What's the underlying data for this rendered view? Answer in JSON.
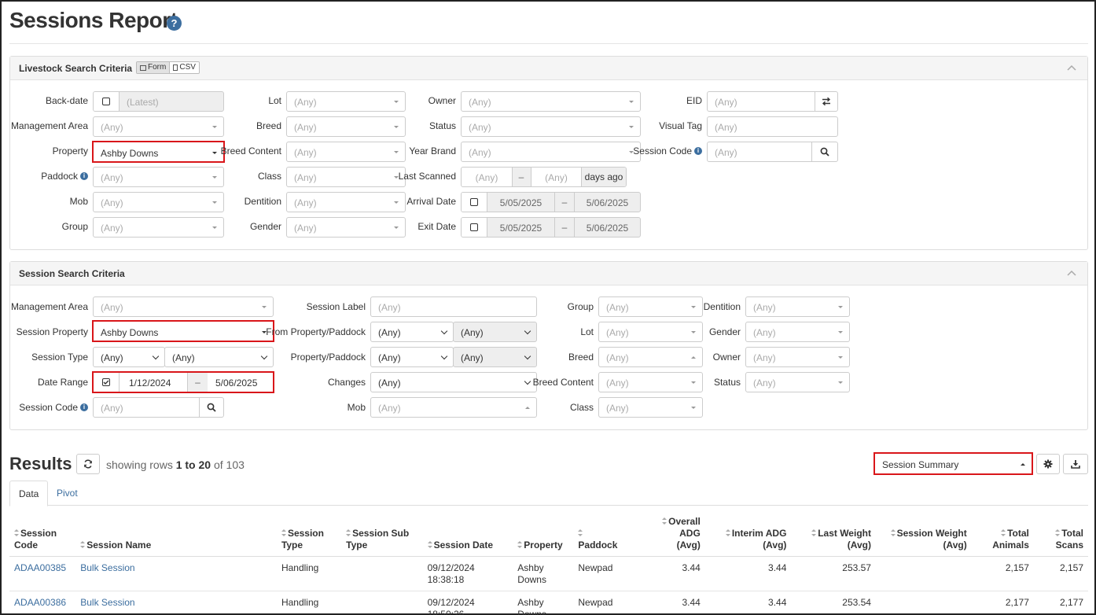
{
  "page": {
    "title": "Sessions Report",
    "help": "?"
  },
  "livestock": {
    "title": "Livestock Search Criteria",
    "form_label": "Form",
    "csv_label": "CSV",
    "backdate": {
      "label": "Back-date",
      "value": "(Latest)"
    },
    "mgmt_area": {
      "label": "Management Area",
      "value": "(Any)"
    },
    "property": {
      "label": "Property",
      "value": "Ashby Downs"
    },
    "paddock": {
      "label": "Paddock",
      "value": "(Any)"
    },
    "mob": {
      "label": "Mob",
      "value": "(Any)"
    },
    "group": {
      "label": "Group",
      "value": "(Any)"
    },
    "lot": {
      "label": "Lot",
      "value": "(Any)"
    },
    "breed": {
      "label": "Breed",
      "value": "(Any)"
    },
    "breed_content": {
      "label": "Breed Content",
      "value": "(Any)"
    },
    "class": {
      "label": "Class",
      "value": "(Any)"
    },
    "dentition": {
      "label": "Dentition",
      "value": "(Any)"
    },
    "gender": {
      "label": "Gender",
      "value": "(Any)"
    },
    "owner": {
      "label": "Owner",
      "value": "(Any)"
    },
    "status": {
      "label": "Status",
      "value": "(Any)"
    },
    "year_brand": {
      "label": "Year Brand",
      "value": "(Any)"
    },
    "last_scanned": {
      "label": "Last Scanned",
      "from": "(Any)",
      "sep": "–",
      "to": "(Any)",
      "suffix": "days ago"
    },
    "arrival_date": {
      "label": "Arrival Date",
      "from": "5/05/2025",
      "sep": "–",
      "to": "5/06/2025"
    },
    "exit_date": {
      "label": "Exit Date",
      "from": "5/05/2025",
      "sep": "–",
      "to": "5/06/2025"
    },
    "eid": {
      "label": "EID",
      "value": "(Any)"
    },
    "visual_tag": {
      "label": "Visual Tag",
      "value": "(Any)"
    },
    "session_code": {
      "label": "Session Code",
      "value": "(Any)"
    }
  },
  "session": {
    "title": "Session Search Criteria",
    "mgmt_area": {
      "label": "Management Area",
      "value": "(Any)"
    },
    "session_property": {
      "label": "Session Property",
      "value": "Ashby Downs"
    },
    "session_type": {
      "label": "Session Type",
      "value1": "(Any)",
      "value2": "(Any)"
    },
    "date_range": {
      "label": "Date Range",
      "from": "1/12/2024",
      "sep": "–",
      "to": "5/06/2025"
    },
    "session_code": {
      "label": "Session Code",
      "value": "(Any)"
    },
    "session_label": {
      "label": "Session Label",
      "value": "(Any)"
    },
    "from_prop": {
      "label": "From Property/Paddock",
      "value1": "(Any)",
      "value2": "(Any)"
    },
    "prop_paddock": {
      "label": "Property/Paddock",
      "value1": "(Any)",
      "value2": "(Any)"
    },
    "changes": {
      "label": "Changes",
      "value": "(Any)"
    },
    "mob": {
      "label": "Mob",
      "value": "(Any)"
    },
    "group": {
      "label": "Group",
      "value": "(Any)"
    },
    "lot": {
      "label": "Lot",
      "value": "(Any)"
    },
    "breed": {
      "label": "Breed",
      "value": "(Any)"
    },
    "breed_content": {
      "label": "Breed Content",
      "value": "(Any)"
    },
    "class": {
      "label": "Class",
      "value": "(Any)"
    },
    "dentition": {
      "label": "Dentition",
      "value": "(Any)"
    },
    "gender": {
      "label": "Gender",
      "value": "(Any)"
    },
    "owner": {
      "label": "Owner",
      "value": "(Any)"
    },
    "status": {
      "label": "Status",
      "value": "(Any)"
    }
  },
  "results": {
    "title": "Results",
    "showing_prefix": "showing rows",
    "range": "1 to 20",
    "of_label": "of",
    "total": "103",
    "view": "Session Summary",
    "tabs": [
      "Data",
      "Pivot"
    ],
    "columns": [
      [
        "Session",
        "Code"
      ],
      [
        "Session Name"
      ],
      [
        "Session",
        "Type"
      ],
      [
        "Session Sub",
        "Type"
      ],
      [
        "Session Date"
      ],
      [
        "Property"
      ],
      [
        "",
        "Paddock"
      ],
      [
        "Overall ADG",
        "(Avg)"
      ],
      [
        "Interim ADG",
        "(Avg)"
      ],
      [
        "Last Weight",
        "(Avg)"
      ],
      [
        "Session Weight",
        "(Avg)"
      ],
      [
        "Total",
        "Animals"
      ],
      [
        "Total",
        "Scans"
      ]
    ],
    "rows": [
      {
        "code": "ADAA00385",
        "name": "Bulk Session",
        "type": "Handling",
        "subtype": "",
        "date": "09/12/2024",
        "time": "18:38:18",
        "property1": "Ashby",
        "property2": "Downs",
        "paddock": "Newpad",
        "overall_adg": "3.44",
        "interim_adg": "3.44",
        "last_weight": "253.57",
        "session_weight": "",
        "total_animals": "2,157",
        "total_scans": "2,157"
      },
      {
        "code": "ADAA00386",
        "name": "Bulk Session",
        "type": "Handling",
        "subtype": "",
        "date": "09/12/2024",
        "time": "18:50:26",
        "property1": "Ashby",
        "property2": "Downs",
        "paddock": "Newpad",
        "overall_adg": "3.44",
        "interim_adg": "3.44",
        "last_weight": "253.54",
        "session_weight": "",
        "total_animals": "2,177",
        "total_scans": "2,177"
      }
    ]
  },
  "colors": {
    "accent": "#3c6e9f",
    "highlight": "#d9161a",
    "link": "#3c6e9f"
  }
}
